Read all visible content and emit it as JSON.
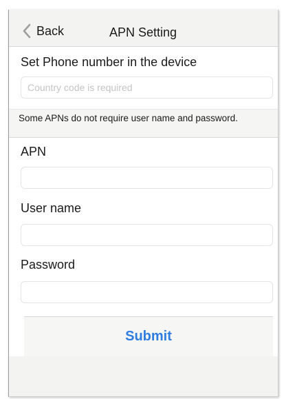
{
  "nav": {
    "back_label": "Back",
    "title": "APN Setting",
    "back_icon": "chevron-left-icon"
  },
  "phone": {
    "label": "Set Phone number in the device",
    "placeholder": "Country code is required",
    "value": ""
  },
  "note": {
    "text": "Some APNs do not require user name and password."
  },
  "apn": {
    "label": "APN",
    "value": ""
  },
  "username": {
    "label": "User name",
    "value": ""
  },
  "password": {
    "label": "Password",
    "value": ""
  },
  "submit": {
    "label": "Submit"
  },
  "colors": {
    "accent": "#2f7de1",
    "background": "#efeff4"
  }
}
